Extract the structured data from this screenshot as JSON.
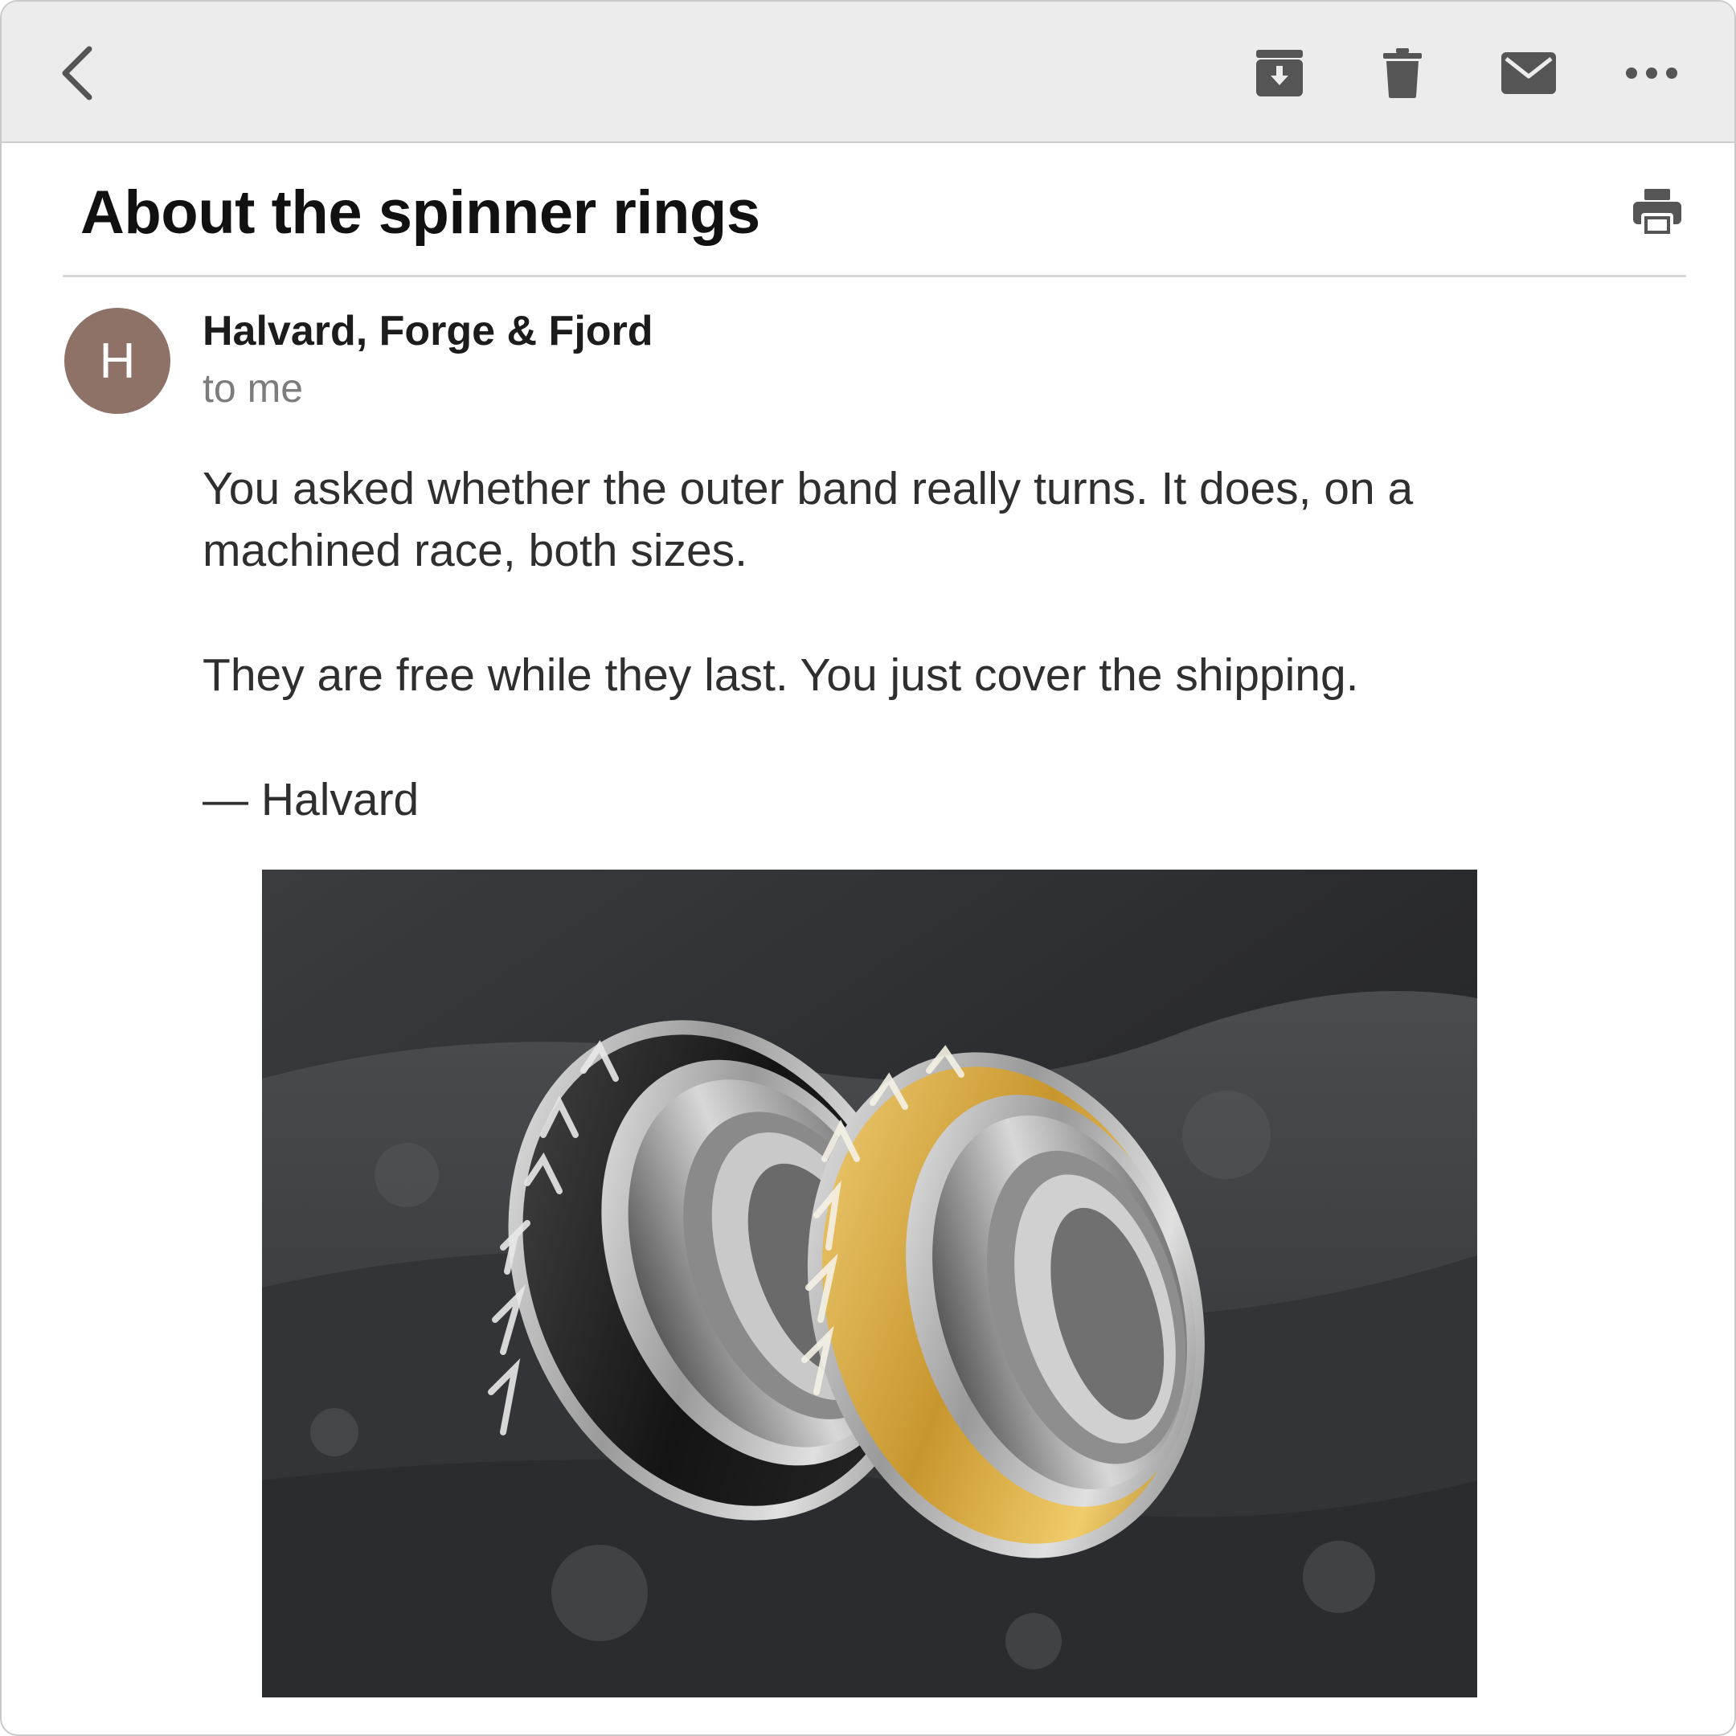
{
  "email": {
    "subject": "About the spinner rings",
    "sender": "Halvard, Forge & Fjord",
    "avatar_initial": "H",
    "recipient": "to me",
    "body": [
      "You asked whether the outer band really turns. It does, on a machined race, both sizes.",
      "They are free while they last. You just cover the shipping."
    ],
    "signature": "— Halvard"
  },
  "toolbar": {
    "icons": [
      "back-icon",
      "archive-icon",
      "trash-icon",
      "mail-icon",
      "more-icon",
      "print-icon"
    ]
  },
  "colors": {
    "toolbar_bg": "#ececec",
    "avatar_bg": "#8e7268",
    "icon_gray": "#555555",
    "body_text": "#2f2f2f",
    "meta_text": "#7c7c7c"
  }
}
